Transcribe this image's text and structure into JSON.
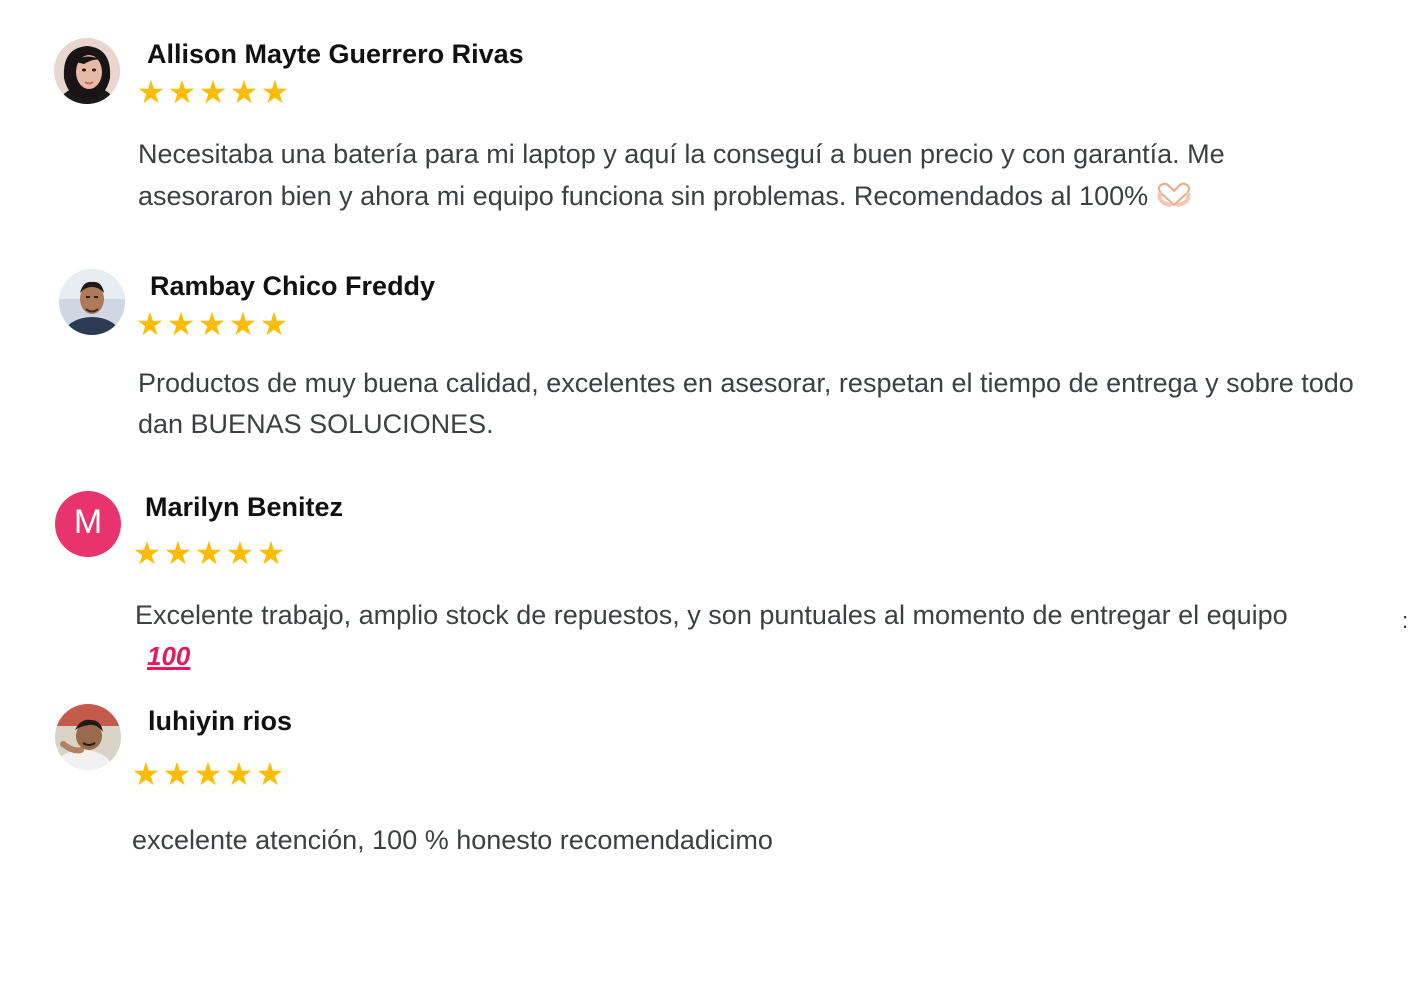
{
  "reviews": [
    {
      "name": "Allison Mayte Guerrero Rivas",
      "rating": 5,
      "text": "Necesitaba una batería para mi laptop y aquí la conseguí a buen precio y con garantía. Me asesoraron bien y ahora mi equipo funciona sin problemas. Recomendados al 100%",
      "emoji": "heart-hands-icon",
      "avatar": "photo"
    },
    {
      "name": "Rambay Chico Freddy",
      "rating": 5,
      "text": "Productos de muy buena calidad, excelentes en asesorar, respetan el tiempo de entrega y sobre todo dan BUENAS SOLUCIONES.",
      "avatar": "photo"
    },
    {
      "name": "Marilyn Benitez",
      "rating": 5,
      "text": "Excelente trabajo, amplio stock de repuestos, y son puntuales al momento de entregar el equipo",
      "emoji": "hundred-points-icon",
      "emoji_text": "100",
      "avatar_letter": "M",
      "avatar_color": "#e8336f"
    },
    {
      "name": "luhiyin rios",
      "rating": 5,
      "text": "excelente atención, 100 % honesto recomendadicimo",
      "avatar": "photo"
    }
  ],
  "colors": {
    "star": "#fbbc04",
    "name": "#111111",
    "text": "#3c4043",
    "hundred": "#e5195e"
  },
  "side_mark": ":"
}
